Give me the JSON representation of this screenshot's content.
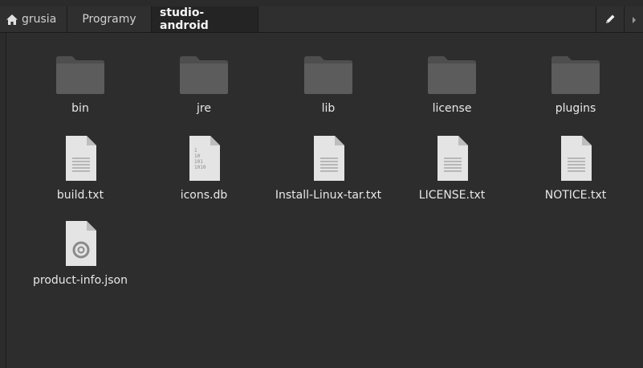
{
  "pathbar": {
    "crumbs": [
      {
        "label": "grusia",
        "icon": "home-icon"
      },
      {
        "label": "Programy"
      },
      {
        "label": "studio-android",
        "active": true
      }
    ],
    "edit_icon": "pencil-icon",
    "scroll_icon": "chevron-right-icon"
  },
  "files": [
    {
      "name": "bin",
      "kind": "folder"
    },
    {
      "name": "jre",
      "kind": "folder"
    },
    {
      "name": "lib",
      "kind": "folder"
    },
    {
      "name": "license",
      "kind": "folder"
    },
    {
      "name": "plugins",
      "kind": "folder"
    },
    {
      "name": "build.txt",
      "kind": "text"
    },
    {
      "name": "icons.db",
      "kind": "binary"
    },
    {
      "name": "Install-Linux-tar.txt",
      "kind": "text"
    },
    {
      "name": "LICENSE.txt",
      "kind": "text"
    },
    {
      "name": "NOTICE.txt",
      "kind": "text"
    },
    {
      "name": "product-info.json",
      "kind": "json"
    }
  ],
  "colors": {
    "background": "#2d2d2d",
    "folder": "#5c5c5c",
    "file_sheet": "#e4e4e4",
    "text": "#e8e8e8"
  }
}
